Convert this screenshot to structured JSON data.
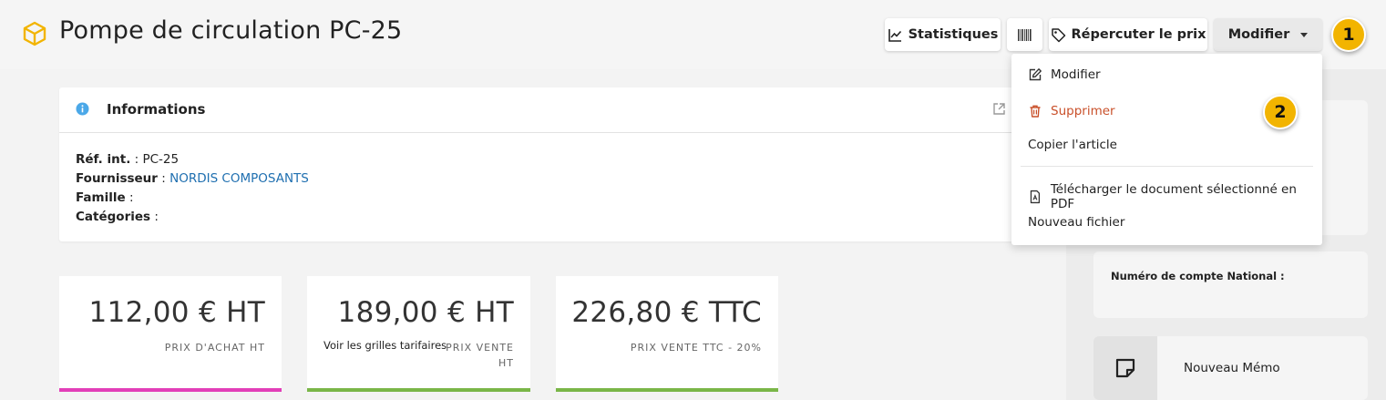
{
  "header": {
    "title": "Pompe de circulation PC-25",
    "box_icon": "package-box-icon",
    "accent_color": "#f2b400"
  },
  "toolbar": {
    "stats_label": "Statistiques",
    "barcode_icon": "barcode-icon",
    "price_label": "Répercuter le prix",
    "modify_label": "Modifier"
  },
  "markers": [
    "1",
    "2"
  ],
  "dropdown": {
    "items": [
      {
        "label": "Modifier",
        "icon": "edit-icon"
      },
      {
        "label": "Supprimer",
        "icon": "trash-icon"
      },
      {
        "label": "Copier l'article"
      },
      {
        "label": "Télécharger le document sélectionné en PDF",
        "icon": "pdf-file-icon"
      },
      {
        "label": "Nouveau fichier"
      }
    ],
    "danger_color": "#c9502a"
  },
  "info": {
    "title": "Informations",
    "fields": [
      {
        "label": "Réf. int.",
        "value": "PC-25"
      },
      {
        "label": "Fournisseur",
        "value": "NORDIS COMPOSANTS"
      },
      {
        "label": "Famille",
        "value": ""
      },
      {
        "label": "Catégories",
        "value": ""
      }
    ],
    "separator": " : "
  },
  "prices": [
    {
      "value": "112,00 € HT",
      "label": "PRIX D'ACHAT HT",
      "color": "#e23fb8"
    },
    {
      "value": "189,00 € HT",
      "label": "PRIX VENTE HT",
      "link": "Voir les grilles tarifaires",
      "color": "#7ab648"
    },
    {
      "value": "226,80 € TTC",
      "label": "PRIX VENTE TTC - 20%",
      "color": "#7ab648"
    }
  ],
  "side": {
    "account_label": "Numéro de compte National :",
    "memo_label": "Nouveau Mémo"
  }
}
